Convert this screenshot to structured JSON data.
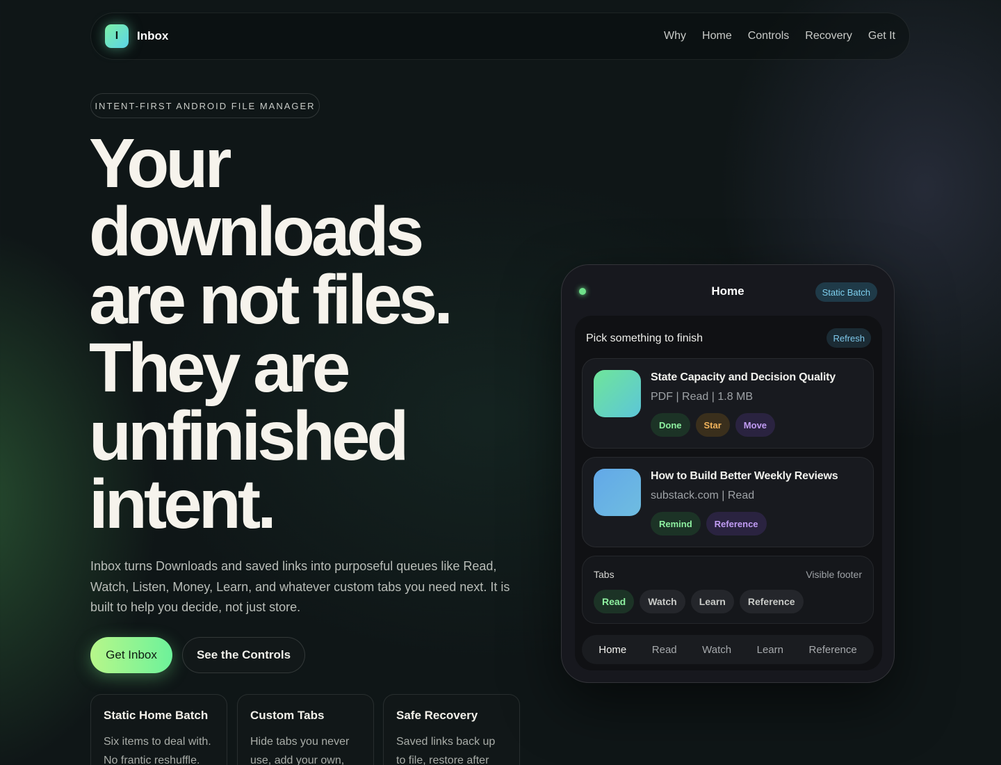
{
  "nav": {
    "brand_letter": "I",
    "brand_name": "Inbox",
    "links": [
      "Why",
      "Home",
      "Controls",
      "Recovery",
      "Get It"
    ]
  },
  "hero": {
    "eyebrow": "INTENT-FIRST ANDROID FILE MANAGER",
    "headline_lines": [
      "Your",
      "downloads",
      "are not files.",
      "They are",
      "unfinished",
      "intent."
    ],
    "lede": "Inbox turns Downloads and saved links into purposeful queues like Read, Watch, Listen, Money, Learn, and whatever custom tabs you need next. It is built to help you decide, not just store.",
    "primary_cta": "Get Inbox",
    "secondary_cta": "See the Controls"
  },
  "features": [
    {
      "title": "Static Home Batch",
      "desc": "Six items to deal with. No frantic reshuffle."
    },
    {
      "title": "Custom Tabs",
      "desc": "Hide tabs you never use, add your own,"
    },
    {
      "title": "Safe Recovery",
      "desc": "Saved links back up to file, restore after"
    }
  ],
  "phone": {
    "title": "Home",
    "status_pill": "Static Batch",
    "panel_heading": "Pick something to finish",
    "refresh_label": "Refresh",
    "items": [
      {
        "title": "State Capacity and Decision Quality",
        "meta": "PDF | Read | 1.8 MB",
        "actions": [
          "Done",
          "Star",
          "Move"
        ]
      },
      {
        "title": "How to Build Better Weekly Reviews",
        "meta": "substack.com | Read",
        "actions": [
          "Remind",
          "Reference"
        ]
      }
    ],
    "tabs_label": "Tabs",
    "tabs_footer_label": "Visible footer",
    "tabs": [
      "Read",
      "Watch",
      "Learn",
      "Reference"
    ],
    "bottom_nav": [
      "Home",
      "Read",
      "Watch",
      "Learn",
      "Reference"
    ]
  },
  "colors": {
    "background": "#0f1617",
    "accent_green": "#8ef0a0",
    "accent_blue": "#7ec8ea",
    "accent_amber": "#f2b45c",
    "accent_purple": "#c19cf4"
  }
}
